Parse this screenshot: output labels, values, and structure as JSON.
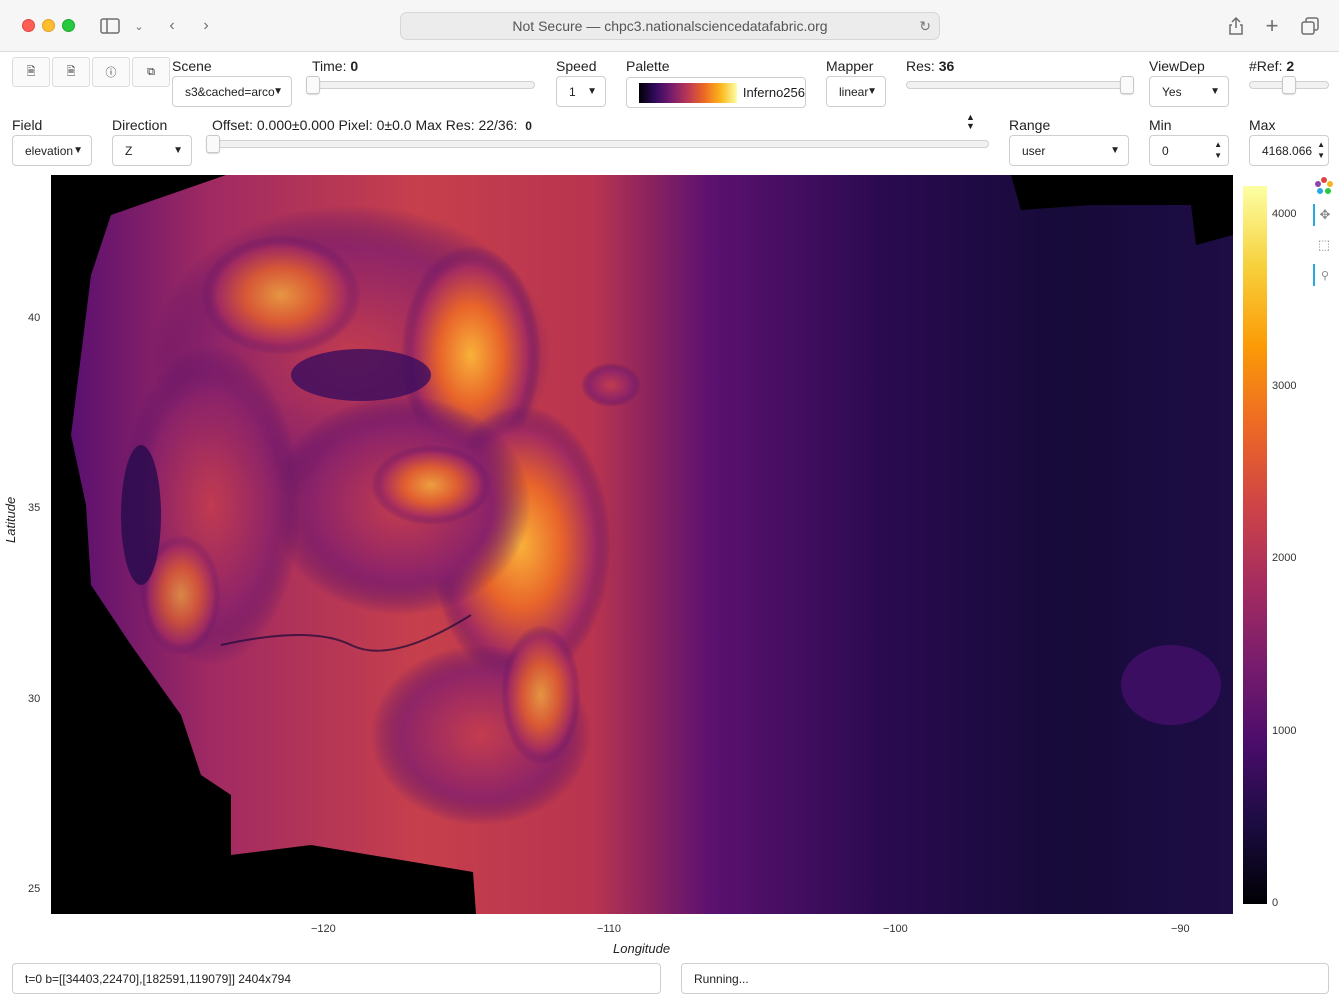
{
  "browser": {
    "url_text": "Not Secure — chpc3.nationalsciencedatafabric.org"
  },
  "toolbar": {
    "scene_label": "Scene",
    "scene_value": "s3&cached=arco",
    "time_label": "Time:",
    "time_value": "0",
    "speed_label": "Speed",
    "speed_value": "1",
    "palette_label": "Palette",
    "palette_value": "Inferno256",
    "mapper_label": "Mapper",
    "mapper_value": "linear",
    "res_label": "Res:",
    "res_value": "36",
    "viewdep_label": "ViewDep",
    "viewdep_value": "Yes",
    "ref_label": "#Ref:",
    "ref_value": "2",
    "field_label": "Field",
    "field_value": "elevation",
    "direction_label": "Direction",
    "direction_value": "Z",
    "offset_text": "Offset: 0.000±0.000 Pixel: 0±0.0 Max Res: 22/36:",
    "offset_value": "0",
    "range_label": "Range",
    "range_value": "user",
    "min_label": "Min",
    "min_value": "0",
    "max_label": "Max",
    "max_value": "4168.066"
  },
  "plot": {
    "x_axis_title": "Longitude",
    "y_axis_title": "Latitude",
    "x_ticks": [
      "−120",
      "−110",
      "−100",
      "−90"
    ],
    "y_ticks": [
      "40",
      "35",
      "30",
      "25"
    ],
    "colorbar_ticks": [
      "4000",
      "3000",
      "2000",
      "1000",
      "0"
    ],
    "palette_colors": [
      "#000004",
      "#320a5e",
      "#781c6d",
      "#bc3754",
      "#ed6925",
      "#fbb61a",
      "#fcffa4"
    ]
  },
  "status": {
    "left_text": "t=0 b=[[34403,22470],[182591,119079]] 2404x794",
    "right_text": "Running..."
  }
}
